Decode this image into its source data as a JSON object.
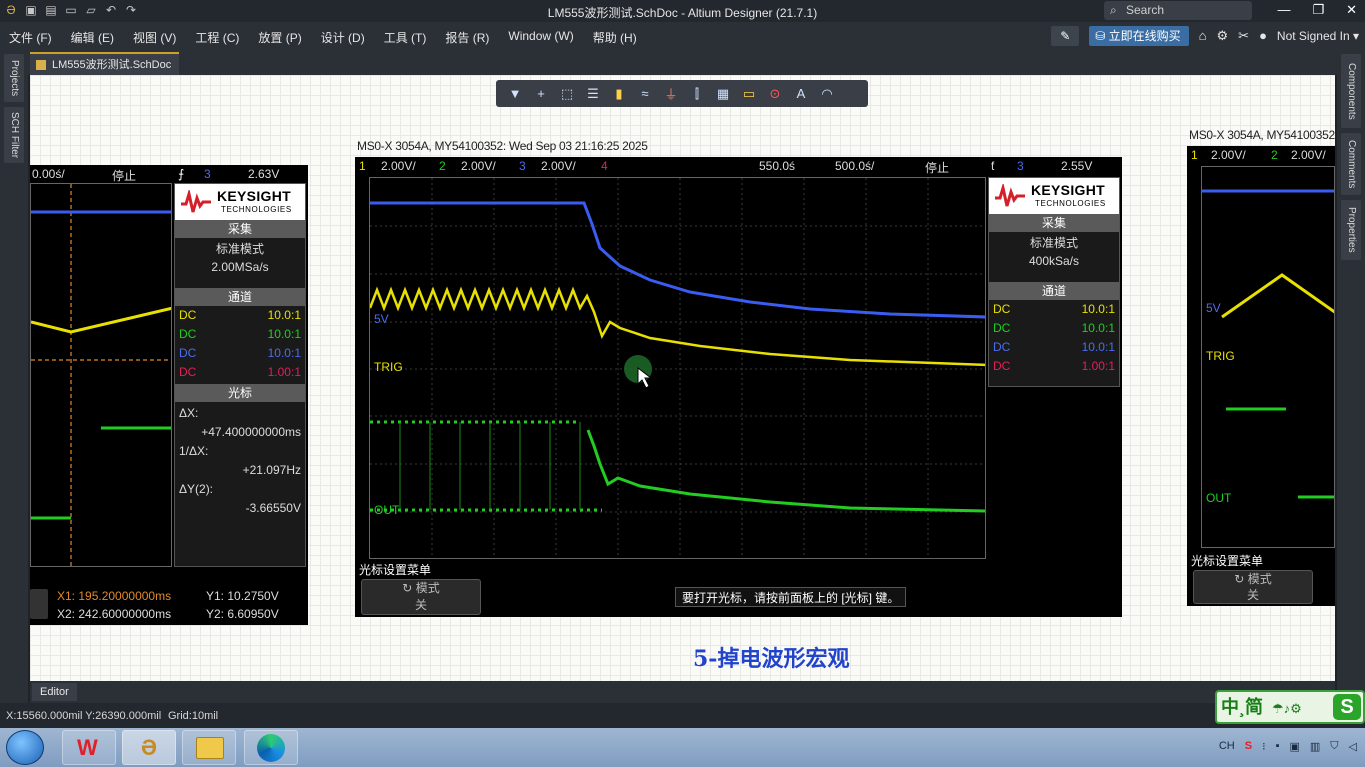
{
  "app": {
    "title": "LM555波形测试.SchDoc - Altium Designer (21.7.1)",
    "search_placeholder": "Search",
    "window_buttons": [
      "—",
      "❐",
      "✕"
    ]
  },
  "menu": {
    "items": [
      "文件 (F)",
      "编辑 (E)",
      "视图 (V)",
      "工程 (C)",
      "放置 (P)",
      "设计 (D)",
      "工具 (T)",
      "报告 (R)",
      "Window (W)",
      "帮助 (H)"
    ],
    "buy_label": "立即在线购买",
    "signed_label": "Not Signed In ▾"
  },
  "left_panels": [
    "Projects",
    "SCH Filter"
  ],
  "right_panels": [
    "Components",
    "Comments",
    "Properties"
  ],
  "doc_tab": "LM555波形测试.SchDoc",
  "editor_tab": "Editor",
  "status": {
    "coords": "X:15560.000mil Y:26390.000mil",
    "grid": "Grid:10mil"
  },
  "ime": {
    "label": "中¸简",
    "logo": "S"
  },
  "caption": "5-掉电波形宏观",
  "scope_main": {
    "header": "MS0-X 3054A, MY54100352: Wed Sep 03 21:16:25 2025",
    "ch1": "1",
    "ch1_scale": "2.00V/",
    "ch2": "2",
    "ch2_scale": "2.00V/",
    "ch3": "3",
    "ch3_scale": "2.00V/",
    "ch4": "4",
    "delay": "550.0ś",
    "timebase": "500.0ś/",
    "state": "停止",
    "trig_ch": "3",
    "trig_level": "2.55V",
    "brand1": "KEYSIGHT",
    "brand2": "TECHNOLOGIES",
    "acq_head": "采集",
    "acq_mode": "标准模式",
    "acq_rate": "400kSa/s",
    "chan_head": "通道",
    "channels": [
      {
        "cpl": "DC",
        "probe": "10.0:1",
        "color": "#e8e000"
      },
      {
        "cpl": "DC",
        "probe": "10.0:1",
        "color": "#22cc22"
      },
      {
        "cpl": "DC",
        "probe": "10.0:1",
        "color": "#4a6cf0"
      },
      {
        "cpl": "DC",
        "probe": "1.00:1",
        "color": "#e0205a"
      }
    ],
    "label_5v": "5V",
    "label_trig": "TRIG",
    "label_out": "OUT",
    "menu_title": "光标设置菜单",
    "softkey_top": "模式",
    "softkey_bot": "关",
    "hint": "要打开光标，请按前面板上的 [光标] 键。"
  },
  "scope_left": {
    "timebase": "0.00ś/",
    "state": "停止",
    "trig_ch": "3",
    "trig_level": "2.63V",
    "brand1": "KEYSIGHT",
    "brand2": "TECHNOLOGIES",
    "acq_head": "采集",
    "acq_mode": "标准模式",
    "acq_rate": "2.00MSa/s",
    "chan_head": "通道",
    "channels": [
      {
        "cpl": "DC",
        "probe": "10.0:1",
        "color": "#e8e000"
      },
      {
        "cpl": "DC",
        "probe": "10.0:1",
        "color": "#22cc22"
      },
      {
        "cpl": "DC",
        "probe": "10.0:1",
        "color": "#4a6cf0"
      },
      {
        "cpl": "DC",
        "probe": "1.00:1",
        "color": "#e0205a"
      }
    ],
    "cursor_head": "光标",
    "dx_label": "ΔX:",
    "dx_val": "+47.400000000ms",
    "inv_label": "1/ΔX:",
    "inv_val": "+21.097Hz",
    "dy_label": "ΔY(2):",
    "dy_val": "-3.66550V",
    "x1": "X1: 195.20000000ms",
    "x2": "X2: 242.60000000ms",
    "y1": "Y1: 10.2750V",
    "y2": "Y2: 6.60950V"
  },
  "scope_right": {
    "header": "MS0-X 3054A, MY54100352",
    "ch1": "1",
    "ch1_scale": "2.00V/",
    "ch2": "2",
    "ch2_scale": "2.00V/",
    "label_5v": "5V",
    "label_trig": "TRIG",
    "label_out": "OUT",
    "menu_title": "光标设置菜单",
    "softkey_top": "模式",
    "softkey_bot": "关"
  }
}
